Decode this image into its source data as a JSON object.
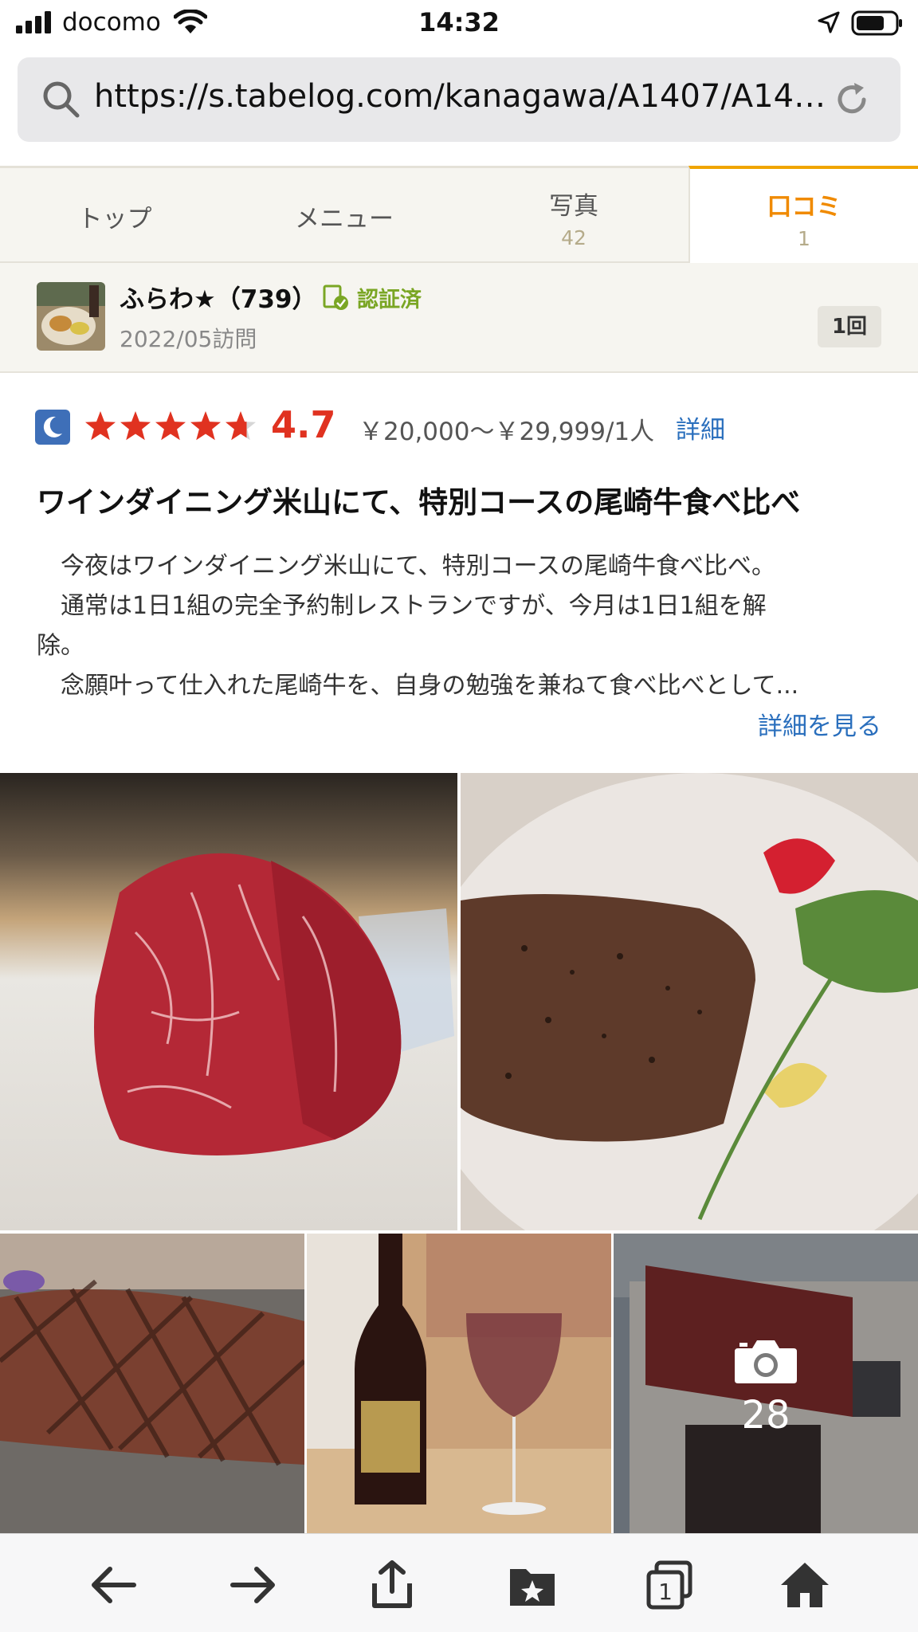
{
  "status_bar": {
    "carrier": "docomo",
    "time": "14:32"
  },
  "browser": {
    "url": "https://s.tabelog.com/kanagawa/A1407/A1407...",
    "icons": [
      "search-icon",
      "reload-icon"
    ]
  },
  "tabs": [
    {
      "label": "トップ",
      "count": ""
    },
    {
      "label": "メニュー",
      "count": ""
    },
    {
      "label": "写真",
      "count": "42"
    },
    {
      "label": "口コミ",
      "count": "1",
      "active": true
    }
  ],
  "reviewer": {
    "name": "ふらわ★（739）",
    "verified_label": "認証済",
    "visit_date": "2022/05訪問",
    "visit_count": "1回"
  },
  "rating": {
    "meal_time_icon": "moon-icon",
    "stars": 4.7,
    "score": "4.7",
    "price": "￥20,000～￥29,999/1人",
    "detail_link": "詳細"
  },
  "review": {
    "title": "ワインダイニング米山にて、特別コースの尾崎牛食べ比べ",
    "body_lines": [
      "　今夜はワインダイニング米山にて、特別コースの尾崎牛食べ比べ。",
      "　通常は1日1組の完全予約制レストランですが、今月は1日1組を解",
      "除。",
      "　念願叶って仕入れた尾崎牛を、自身の勉強を兼ねて食べ比べとして..."
    ],
    "read_more": "詳細を見る"
  },
  "photos": {
    "more_count": "28"
  },
  "colors": {
    "accent_orange": "#f08a00",
    "score_red": "#e03220",
    "link_blue": "#2a6fbd",
    "verified_green": "#7aa624"
  }
}
